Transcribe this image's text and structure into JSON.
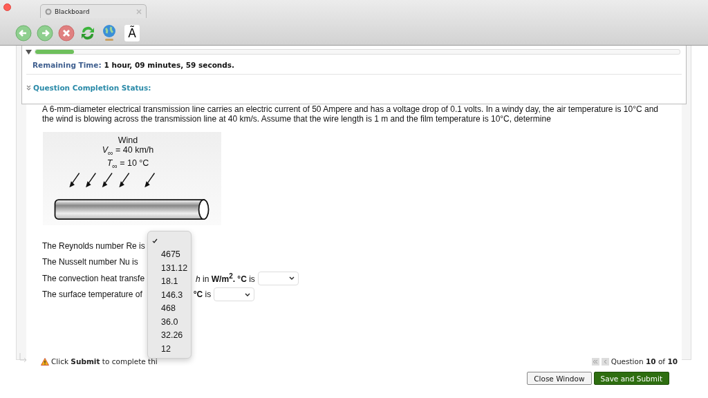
{
  "browser": {
    "tab_title": "Blackboard",
    "toolbar_glyph": "Ã"
  },
  "timer": {
    "expanded": true,
    "level": 0.06,
    "label": "Remaining Time:",
    "value": "1 hour, 09 minutes, 59 seconds."
  },
  "completion_status": {
    "label": "Question Completion Status:",
    "expanded": false
  },
  "question": {
    "text": "A 6-mm-diameter electrical transmission line carries an electric current of 50 Ampere and has a voltage drop of 0.1 volts. In a windy day, the air temperature is 10°C and the wind is blowing across the transmission line at 40 km/s. Assume that the wire length is 1 m and the film temperature is 10°C, determine",
    "figure": {
      "labels": [
        "Wind",
        "*V*$_{∞}$ = 40 km/h",
        "*T*$_{∞}$ = 10 °C"
      ]
    },
    "items": [
      {
        "before": "The Reynolds number Re is",
        "select_visible": false
      },
      {
        "before": "The Nusselt number Nu is",
        "select_visible": false
      },
      {
        "before": "The convection heat transfe",
        "after": "*h* in **W/m$^{2}$. °C** is",
        "select_visible": true
      },
      {
        "before": "The surface temperature of",
        "after": "**°C** is",
        "select_visible": true
      }
    ],
    "open_menu": {
      "options": [
        {
          "checked": true
        },
        {
          "label": "4675",
          "checked": false
        },
        {
          "label": "131.12",
          "checked": false
        },
        {
          "label": "18.1",
          "checked": false
        },
        {
          "label": "146.3",
          "checked": false
        },
        {
          "label": "468",
          "checked": false
        },
        {
          "label": "36.0",
          "checked": false
        },
        {
          "label": "32.26",
          "checked": false
        },
        {
          "label": "12",
          "checked": false
        }
      ]
    }
  },
  "notice": "Click **Submit** to complete thi",
  "pagination": {
    "text": "Question **10** of **10**"
  },
  "buttons": [
    {
      "label": "Close Window",
      "kind": "secondary"
    },
    {
      "label": "Save and Submit",
      "kind": "primary"
    }
  ]
}
